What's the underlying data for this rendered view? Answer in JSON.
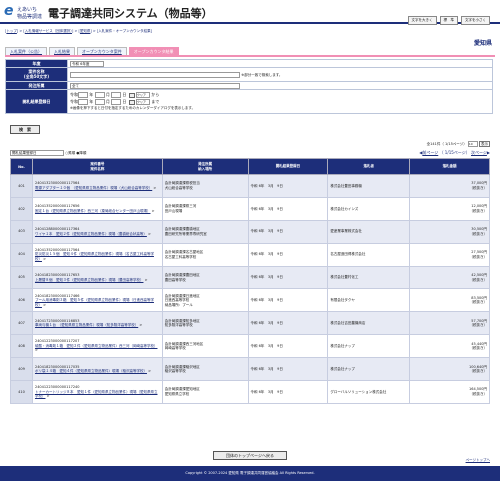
{
  "logo": {
    "line1": "えあいち",
    "line2": "物品等調達"
  },
  "app_title": "電子調達共同システム（物品等）",
  "font_size": {
    "small": "文字を大きく",
    "normal": "標　準",
    "large": "文字を小さく"
  },
  "breadcrumb": [
    "トップ",
    "入札情報サービス（団体選択）",
    "愛知県",
    "入札案件・オープンカウンタ結果"
  ],
  "prefecture": "愛知県",
  "tabs": [
    "入札案件（公告）",
    "入札結果",
    "オープンカウンタ案件",
    "オープンカウンタ結果"
  ],
  "form": {
    "year_label": "年度",
    "year_value": "令和 6年度",
    "case_label": "案件名称\n(全角50文字)",
    "case_hint": "※部分一致で検索します。",
    "dept_label": "発注所属",
    "dept_value": "全て",
    "date_label": "開札結果登録日",
    "era": "令和",
    "from_label": "から",
    "to_label": "まで",
    "clear": "クリア",
    "note": "※画像を押下すると日付を指定するためのカレンダーダイアログを表示します。"
  },
  "search_btn": "検　索",
  "count": "全141件（ 1/15ページ）",
  "per_page": "10",
  "sort_select": "開札結果登録日",
  "sort_asc": "昇順",
  "sort_desc": "降順",
  "prev": "前ページ",
  "next": "次ページ",
  "page_info": "（ 1/15ページ）",
  "cols": [
    "No.",
    "案件番号\n案件名称",
    "発注所属\n納入場所",
    "開札結果登録日",
    "落札者",
    "落札金額"
  ],
  "rows": [
    {
      "no": "401",
      "id": "24041323000000117564",
      "name": "電源アダプター１０個　〈愛知県県立物品業件〉現場（犬山総合高等学校）",
      "dept": "会計局調達課県税担当",
      "place": "犬山総合高等学校",
      "date": "令和 6年　3月　9日",
      "winner": "株式会社豊田事務機",
      "amt": "37,000円",
      "tax": "（税抜き）"
    },
    {
      "no": "402",
      "id": "24041352000000117656",
      "name": "固定１台〈愛知県県立物品業件〉西三河（薬局総合センター田戸山現場）",
      "dept": "会計局調達課県三河",
      "place": "田戸山現場",
      "date": "令和 6年　3月　9日",
      "winner": "株式会社カインズ",
      "amt": "12,000円",
      "tax": "（税抜き）"
    },
    {
      "no": "403",
      "id": "24041288000000117364",
      "name": "ワイヤ１本　愛知２件〈愛知県県立物品業件〉現場（豊橋総合状高等）",
      "dept": "会計局調達課豊橋地区",
      "place": "豊田研究所等業界専研究室",
      "date": "令和 6年　3月　9日",
      "winner": "愛産業事業株式会社",
      "amt": "30,500円",
      "tax": "（税抜き）"
    },
    {
      "no": "404",
      "id": "24041352000000117564",
      "name": "防災防災１５個　愛知４件〈愛知県県立物品業件〉現場（名古屋工科高等学校）",
      "dept": "会計局調達課名古屋地区",
      "place": "名古屋工科高等学校",
      "date": "令和 6年　3月　9日",
      "winner": "名古屋造田得株式会社",
      "amt": "27,500円",
      "tax": "（税抜き）"
    },
    {
      "no": "405",
      "id": "24041823000000117653",
      "name": "上履替８個　愛知３件〈愛知県県立物品業件〉現場（豊田高等学校）",
      "dept": "会計局調達課豊田地区",
      "place": "豊田高等学校",
      "date": "令和 6年　3月　9日",
      "winner": "株式会社豊村化工",
      "amt": "42,500円",
      "tax": "（税抜き）"
    },
    {
      "no": "406",
      "id": "24041823000000117466",
      "name": "プール用消毒剤３箱　愛知５件〈愛知県県立物品業件〉現場（日進西高等学校）",
      "dept": "会計局調達課日進地区",
      "place": "日進西高等学校\n納品場所：プール",
      "date": "令和 6年　3月　9日",
      "winner": "有限会社タクヤ",
      "amt": "83,500円",
      "tax": "（税抜き）"
    },
    {
      "no": "407",
      "id": "24041723000000116853",
      "name": "車両与機１台　〈愛知県県立物品業件〉現場（知多翔洋高等学校）",
      "dept": "会計局調達課知多地区",
      "place": "知多翔洋高等学校",
      "date": "令和 6年　3月　9日",
      "winner": "株式会社吉田農機商店",
      "amt": "57,700円",
      "tax": "（税抜き）"
    },
    {
      "no": "408",
      "id": "24041223000000117207",
      "name": "硫酸・消毒剤１箱　愛知２件〈愛知県県立物品業件〉西三河（岡崎高等学校）",
      "dept": "会計局調達課西三河地区",
      "place": "岡崎高等学校",
      "date": "令和 6年　3月　9日",
      "winner": "株式会社ナップ",
      "amt": "45,440円",
      "tax": "（税抜き）"
    },
    {
      "no": "409",
      "id": "24041823000000117035",
      "name": "ポリ袋１４箱　愛知４件〈愛知県県立物品業件〉現場（稲沢高等学校）",
      "dept": "会計局調達課稲沢地区",
      "place": "稲沢高等学校",
      "date": "令和 6年　3月　9日",
      "winner": "株式会社ナップ",
      "amt": "100,640円",
      "tax": "（税抜き）"
    },
    {
      "no": "410",
      "id": "24041223000000117240",
      "name": "トナーカートリッジ８本　愛知１件〈愛知県県立物品業件〉現場（愛知県県立学校）",
      "dept": "会計局調達課愛知地区",
      "place": "愛知県県立学校",
      "date": "令和 6年　3月　9日",
      "winner": "グローバルソリューション株式会社",
      "amt": "164,500円",
      "tax": "（税抜き）"
    }
  ],
  "top_btn": "団体のトップページへ戻る",
  "page_top": "ページトップへ",
  "copyright": "Copyright © 2007-2024 愛知県 電子調達共同運営協議会 All Rights Reserved."
}
